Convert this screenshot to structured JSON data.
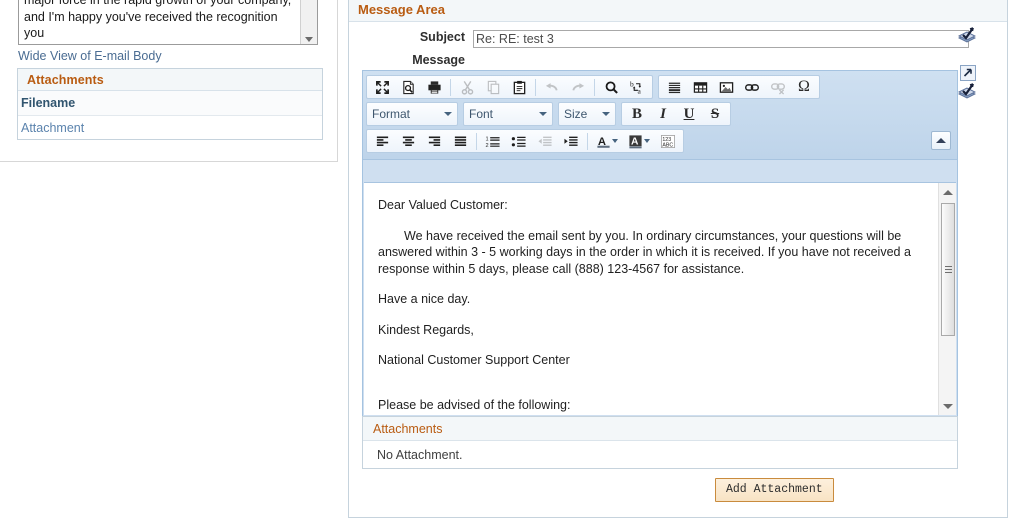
{
  "left_panel": {
    "email_body_text": "major force in the rapid growth of your company,\nand I'm happy you've received the recognition you\nso richly deserve.",
    "wide_view_link": "Wide View of E-mail Body",
    "attachments_panel": {
      "title": "Attachments",
      "column_header": "Filename",
      "rows": [
        {
          "filename": "Attachment"
        }
      ]
    }
  },
  "message_area": {
    "title": "Message Area",
    "subject": {
      "label": "Subject",
      "value": "Re: RE: test 3",
      "placeholder": ""
    },
    "message_label": "Message",
    "lookup_icon_name": "spell-check-book-icon",
    "popup_icon_name": "open-in-new-window-icon"
  },
  "editor": {
    "toolbar": {
      "row1": [
        {
          "name": "maximize-icon",
          "label": "Maximize",
          "glyph": "maximize",
          "disabled": false
        },
        {
          "name": "preview-icon",
          "label": "Preview",
          "glyph": "preview",
          "disabled": false
        },
        {
          "name": "print-icon",
          "label": "Print",
          "glyph": "print",
          "disabled": false
        },
        {
          "name": "cut-icon",
          "label": "Cut",
          "glyph": "cut",
          "disabled": true
        },
        {
          "name": "copy-icon",
          "label": "Copy",
          "glyph": "copy",
          "disabled": true
        },
        {
          "name": "paste-icon",
          "label": "Paste",
          "glyph": "paste",
          "disabled": false
        },
        {
          "name": "undo-icon",
          "label": "Undo",
          "glyph": "undo",
          "disabled": true
        },
        {
          "name": "redo-icon",
          "label": "Redo",
          "glyph": "redo",
          "disabled": true
        },
        {
          "name": "find-icon",
          "label": "Find",
          "glyph": "find",
          "disabled": false
        },
        {
          "name": "replace-icon",
          "label": "Replace",
          "glyph": "replace",
          "disabled": false
        },
        {
          "name": "horizontal-rule-icon",
          "label": "Horizontal Line",
          "glyph": "hrule",
          "disabled": false
        },
        {
          "name": "table-icon",
          "label": "Table",
          "glyph": "table",
          "disabled": false
        },
        {
          "name": "image-icon",
          "label": "Image",
          "glyph": "image",
          "disabled": false
        },
        {
          "name": "link-icon",
          "label": "Link",
          "glyph": "link",
          "disabled": false
        },
        {
          "name": "unlink-icon",
          "label": "Unlink",
          "glyph": "unlink",
          "disabled": true
        },
        {
          "name": "special-character-icon",
          "label": "Special Character",
          "glyph": "omega",
          "disabled": false
        }
      ],
      "combos": [
        {
          "name": "format-dropdown",
          "label": "Format"
        },
        {
          "name": "font-dropdown",
          "label": "Font"
        },
        {
          "name": "size-dropdown",
          "label": "Size"
        }
      ],
      "styles": [
        {
          "name": "bold-button",
          "label": "B"
        },
        {
          "name": "italic-button",
          "label": "I"
        },
        {
          "name": "underline-button",
          "label": "U"
        },
        {
          "name": "strikethrough-button",
          "label": "S"
        }
      ],
      "row3": [
        {
          "name": "align-left-icon",
          "label": "Align Left",
          "glyph": "align-left",
          "disabled": false
        },
        {
          "name": "align-center-icon",
          "label": "Center",
          "glyph": "align-center",
          "disabled": false
        },
        {
          "name": "align-right-icon",
          "label": "Align Right",
          "glyph": "align-right",
          "disabled": false
        },
        {
          "name": "align-justify-icon",
          "label": "Justify",
          "glyph": "align-just",
          "disabled": false
        },
        {
          "name": "numbered-list-icon",
          "label": "Numbered List",
          "glyph": "ol",
          "disabled": false
        },
        {
          "name": "bulleted-list-icon",
          "label": "Bulleted List",
          "glyph": "ul",
          "disabled": false
        },
        {
          "name": "outdent-icon",
          "label": "Decrease Indent",
          "glyph": "outdent",
          "disabled": true
        },
        {
          "name": "indent-icon",
          "label": "Increase Indent",
          "glyph": "indent",
          "disabled": false
        },
        {
          "name": "text-color-icon",
          "label": "Text Color",
          "glyph": "text-color",
          "disabled": false
        },
        {
          "name": "background-color-icon",
          "label": "Background Color",
          "glyph": "bg-color",
          "disabled": false
        },
        {
          "name": "spell-check-icon",
          "label": "Spell Check",
          "glyph": "spellcheck",
          "disabled": false
        }
      ],
      "collapse_button_name": "collapse-toolbar-button"
    },
    "body_paragraphs": [
      {
        "text": "Dear Valued Customer:",
        "indent": false,
        "gap": false
      },
      {
        "text": "We have received the email sent by you. In ordinary circumstances, your questions will be answered within 3 - 5 working days in the order in which it is received. If you have not received a response within 5 days, please call (888) 123-4567 for assistance.",
        "indent": true,
        "gap": false
      },
      {
        "text": "Have a nice day.",
        "indent": false,
        "gap": false
      },
      {
        "text": "Kindest Regards,",
        "indent": false,
        "gap": false
      },
      {
        "text": "National Customer Support Center",
        "indent": false,
        "gap": true
      },
      {
        "text": "Please be advised of the following:",
        "indent": false,
        "gap": false
      }
    ]
  },
  "attachments_section": {
    "title": "Attachments",
    "empty_text": "No Attachment.",
    "add_button_label": "Add Attachment"
  },
  "colors": {
    "panel_title": "#b95c12",
    "panel_header_bg": "#f3f7f9",
    "panel_border": "#c6d3dd",
    "toolbar_bg": "#c3d7ec",
    "link": "#5b83ad",
    "button_border": "#c98b3d",
    "button_bg": "#f8e3c4"
  }
}
